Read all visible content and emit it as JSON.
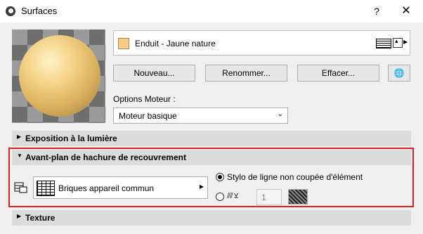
{
  "window": {
    "title": "Surfaces",
    "help": "?",
    "close": "✕"
  },
  "material": {
    "name": "Enduit - Jaune nature",
    "swatch_color": "#f9cc88"
  },
  "buttons": {
    "new": "Nouveau...",
    "rename": "Renommer...",
    "delete": "Effacer...",
    "globe": "🌐"
  },
  "engine": {
    "label": "Options Moteur :",
    "value": "Moteur basique"
  },
  "sections": {
    "exposure": "Exposition à la lumière",
    "cover_fill": "Avant-plan de hachure de recouvrement",
    "texture": "Texture"
  },
  "cover_fill": {
    "fill_name": "Briques appareil commun",
    "option_element_pen": "Stylo de ligne non coupée d'élément",
    "pen_number": "1"
  },
  "accent": "#e02020"
}
